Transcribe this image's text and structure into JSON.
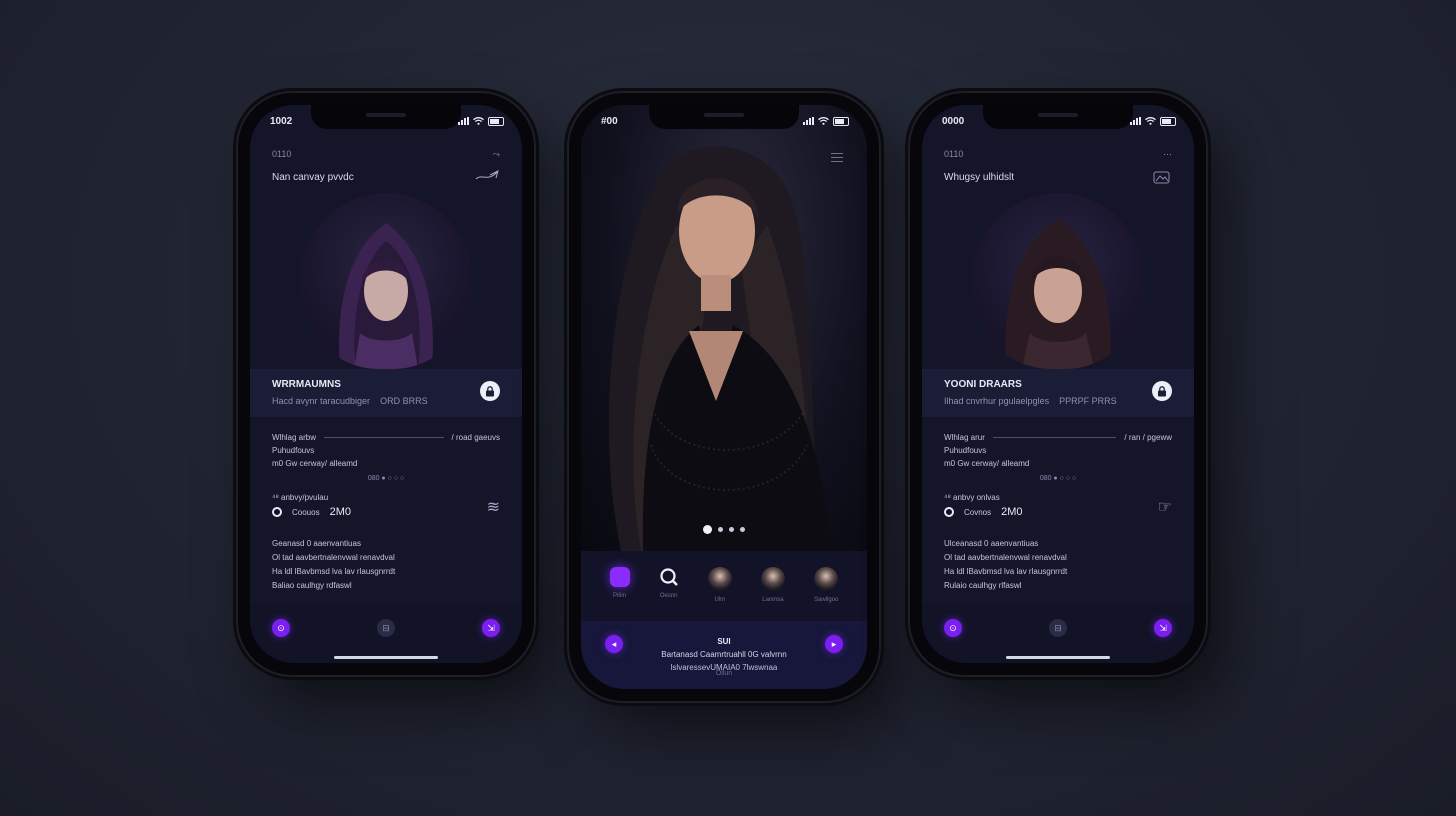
{
  "phones": {
    "left": {
      "time": "1002",
      "topbar_label": "0110",
      "heading": "Nan canvay pvvdc",
      "profile_name": "WRRMAUMNS",
      "profile_sub1": "Hacd avynr taracudbiger",
      "profile_sub2": "ORD BRRS",
      "block1_title": "Wlhlag arbw",
      "block1_right": "/ road gaeuvs",
      "block1_line2": "Puhudfouvs",
      "block1_line3": "m0 Gw cerway/ alleamd",
      "block1_dots": "080 ● ○ ○ ○",
      "block2_label": "⁴⁸ anbvy/pvulau",
      "block2_caption": "Coouos",
      "block2_value": "2M0",
      "block3_line1": "Geanasd 0 aaenvantiuas",
      "block3_line2": "Ol tad aavbertnalenvwal renavdval",
      "block3_line3": "Ha ldl lBavbmsd lva lav rlausgnrrdt",
      "block3_line4": "Baliao caulhgy rdfaswl"
    },
    "middle": {
      "time": "#00",
      "tray_labels": [
        "Pitiin",
        "Oesnn",
        "Ulm",
        "Lanmsa",
        "Sawllgoo"
      ],
      "footer_title": "SUI",
      "footer_line2": "Bartanasd Caamrtruahll 0G valvrnn",
      "footer_line3": "lslvaressevUMAIA0 7lwswnaa",
      "footer_more": "Ollun"
    },
    "right": {
      "time": "0000",
      "topbar_label": "0110",
      "heading": "Whugsy ulhidslt",
      "profile_name": "YOONI DRAARS",
      "profile_sub1": "Ilhad cnvrhur pgulaelpgles",
      "profile_sub2": "PPRPF PRRS",
      "block1_title": "Wlhlag arur",
      "block1_right": "/ ran / pgeww",
      "block1_line2": "Puhudfouvs",
      "block1_line3": "m0 Gw cerway/ alleamd",
      "block1_dots": "080 ● ○ ○ ○",
      "block2_label": "⁴⁸ anbvy onlvas",
      "block2_caption": "Covnos",
      "block2_value": "2M0",
      "block3_line1": "Ulceanasd 0 aaenvantiuas",
      "block3_line2": "Ol tad aavbertnalenvwal renavdval",
      "block3_line3": "Ha ldl lBavbmsd lva lav rlausgnrrdt",
      "block3_line4": "Rulaio caulhgy rlfaswl"
    }
  },
  "colors": {
    "accent": "#7a1ff0",
    "screen_bg": "#15152a",
    "band_bg": "#1b1c36"
  }
}
